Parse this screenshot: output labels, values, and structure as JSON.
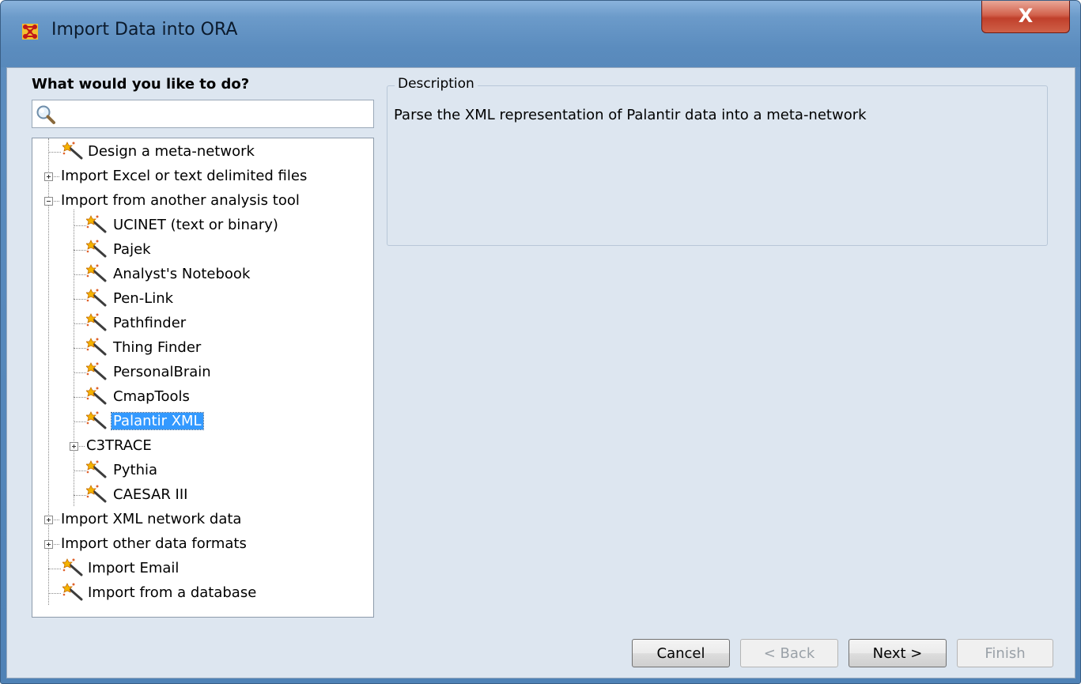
{
  "window": {
    "title": "Import Data into ORA",
    "close_label": "X"
  },
  "left_panel": {
    "prompt": "What would you like to do?",
    "search": {
      "value": "",
      "placeholder": ""
    }
  },
  "tree": {
    "items": [
      {
        "label": "Design a meta-network",
        "type": "leaf",
        "selected": false
      },
      {
        "label": "Import Excel or text delimited files",
        "type": "collapsed-folder",
        "selected": false
      },
      {
        "label": "Import from another analysis tool",
        "type": "expanded-folder",
        "selected": false
      },
      {
        "label": "UCINET (text or binary)",
        "type": "leaf",
        "selected": false
      },
      {
        "label": "Pajek",
        "type": "leaf",
        "selected": false
      },
      {
        "label": "Analyst's Notebook",
        "type": "leaf",
        "selected": false
      },
      {
        "label": "Pen-Link",
        "type": "leaf",
        "selected": false
      },
      {
        "label": "Pathfinder",
        "type": "leaf",
        "selected": false
      },
      {
        "label": "Thing Finder",
        "type": "leaf",
        "selected": false
      },
      {
        "label": "PersonalBrain",
        "type": "leaf",
        "selected": false
      },
      {
        "label": "CmapTools",
        "type": "leaf",
        "selected": false
      },
      {
        "label": "Palantir XML",
        "type": "leaf",
        "selected": true
      },
      {
        "label": "C3TRACE",
        "type": "collapsed-folder",
        "selected": false
      },
      {
        "label": "Pythia",
        "type": "leaf",
        "selected": false
      },
      {
        "label": "CAESAR III",
        "type": "leaf",
        "selected": false
      },
      {
        "label": "Import XML network data",
        "type": "collapsed-folder",
        "selected": false
      },
      {
        "label": "Import other data formats",
        "type": "collapsed-folder",
        "selected": false
      },
      {
        "label": "Import Email",
        "type": "leaf",
        "selected": false
      },
      {
        "label": "Import from a database",
        "type": "leaf",
        "selected": false
      }
    ]
  },
  "description": {
    "legend": "Description",
    "text": "Parse the XML representation of Palantir data into a meta-network"
  },
  "buttons": {
    "cancel": "Cancel",
    "back": "< Back",
    "next": "Next >",
    "finish": "Finish"
  },
  "icons": {
    "app": "ora-network-icon",
    "search": "magnifier-icon",
    "wizard": "magic-wand-icon"
  },
  "colors": {
    "selection": "#3399ff",
    "title_bar": "#6c9bca",
    "close_button": "#c0402b",
    "client_background": "#dde6f0"
  }
}
